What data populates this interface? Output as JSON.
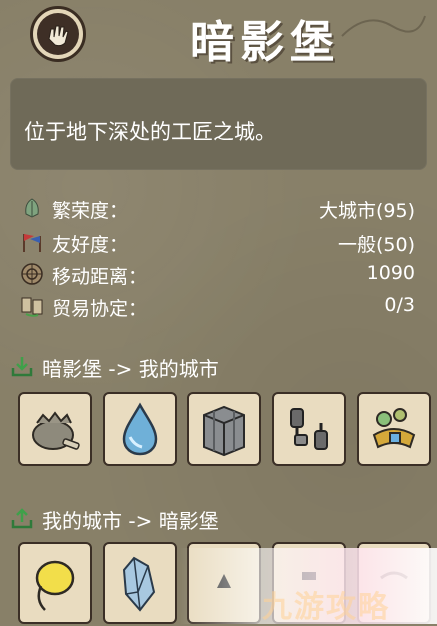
{
  "city": {
    "title": "暗影堡",
    "description": "位于地下深处的工匠之城。"
  },
  "stats": [
    {
      "icon": "leaf-icon",
      "label": "繁荣度：",
      "value": "大城市(95)"
    },
    {
      "icon": "flags-icon",
      "label": "友好度：",
      "value": "一般(50)"
    },
    {
      "icon": "compass-icon",
      "label": "移动距离：",
      "value": "1090"
    },
    {
      "icon": "trade-icon",
      "label": "贸易协定：",
      "value": "0/3"
    }
  ],
  "sections": {
    "import_title": "暗影堡 -> 我的城市",
    "export_title": "我的城市 -> 暗影堡"
  },
  "import_items": [
    "bag-icon",
    "water-drop-icon",
    "crate-icon",
    "dumbbell-icon",
    "jewelry-icon"
  ],
  "export_items": [
    "yellow-drop-icon",
    "crystal-icon",
    "item-icon",
    "item-icon",
    "item-icon"
  ],
  "watermark": "九游攻略",
  "colors": {
    "background": "#888068",
    "panel": "#6f6a58",
    "slot": "#e9dcc0"
  }
}
